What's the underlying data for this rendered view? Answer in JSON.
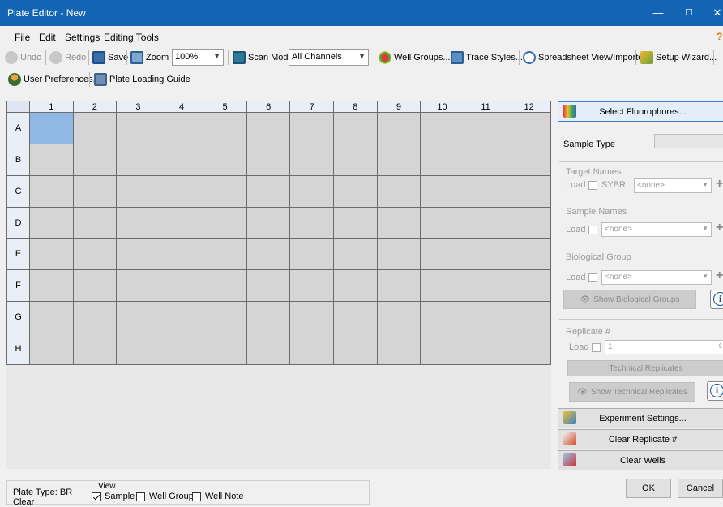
{
  "window": {
    "title": "Plate Editor - New",
    "minimize": "—",
    "maximize": "☐",
    "close": "✕"
  },
  "menu": {
    "file": "File",
    "edit": "Edit",
    "settings": "Settings",
    "editing_tools": "Editing Tools"
  },
  "toolbar1": {
    "undo": "Undo",
    "redo": "Redo",
    "save": "Save",
    "zoom": "Zoom",
    "zoom_value": "100%",
    "scan_mode": "Scan Mode",
    "scan_value": "All Channels",
    "well_groups": "Well Groups...",
    "trace_styles": "Trace Styles...",
    "spreadsheet": "Spreadsheet View/Importer",
    "setup_wizard": "Setup Wizard..."
  },
  "toolbar2": {
    "user_prefs": "User Preferences...",
    "plate_loading": "Plate Loading Guide"
  },
  "plate": {
    "columns": [
      "1",
      "2",
      "3",
      "4",
      "5",
      "6",
      "7",
      "8",
      "9",
      "10",
      "11",
      "12"
    ],
    "rows": [
      "A",
      "B",
      "C",
      "D",
      "E",
      "F",
      "G",
      "H"
    ],
    "selected_well": "A1"
  },
  "panel": {
    "select_fluorophores": "Select Fluorophores...",
    "sample_type_label": "Sample Type",
    "target_names_label": "Target Names",
    "load": "Load",
    "sybr": "SYBR",
    "none": "<none>",
    "sample_names_label": "Sample Names",
    "biological_group_label": "Biological Group",
    "show_biological_groups": "Show Biological Groups",
    "replicate_label": "Replicate #",
    "replicate_value": "1",
    "technical_replicates": "Technical Replicates",
    "show_technical_replicates": "Show Technical Replicates",
    "experiment_settings": "Experiment Settings...",
    "clear_replicate": "Clear Replicate #",
    "clear_wells": "Clear Wells"
  },
  "status": {
    "plate_type": "Plate Type: BR Clear",
    "view_label": "View",
    "sample": "Sample",
    "well_group": "Well Group",
    "well_note": "Well Note"
  },
  "dialog": {
    "ok": "OK",
    "cancel": "Cancel"
  },
  "colors": {
    "titlebar": "#1464b4",
    "selected_well": "#90b8e4",
    "well": "#d5d5d5"
  }
}
